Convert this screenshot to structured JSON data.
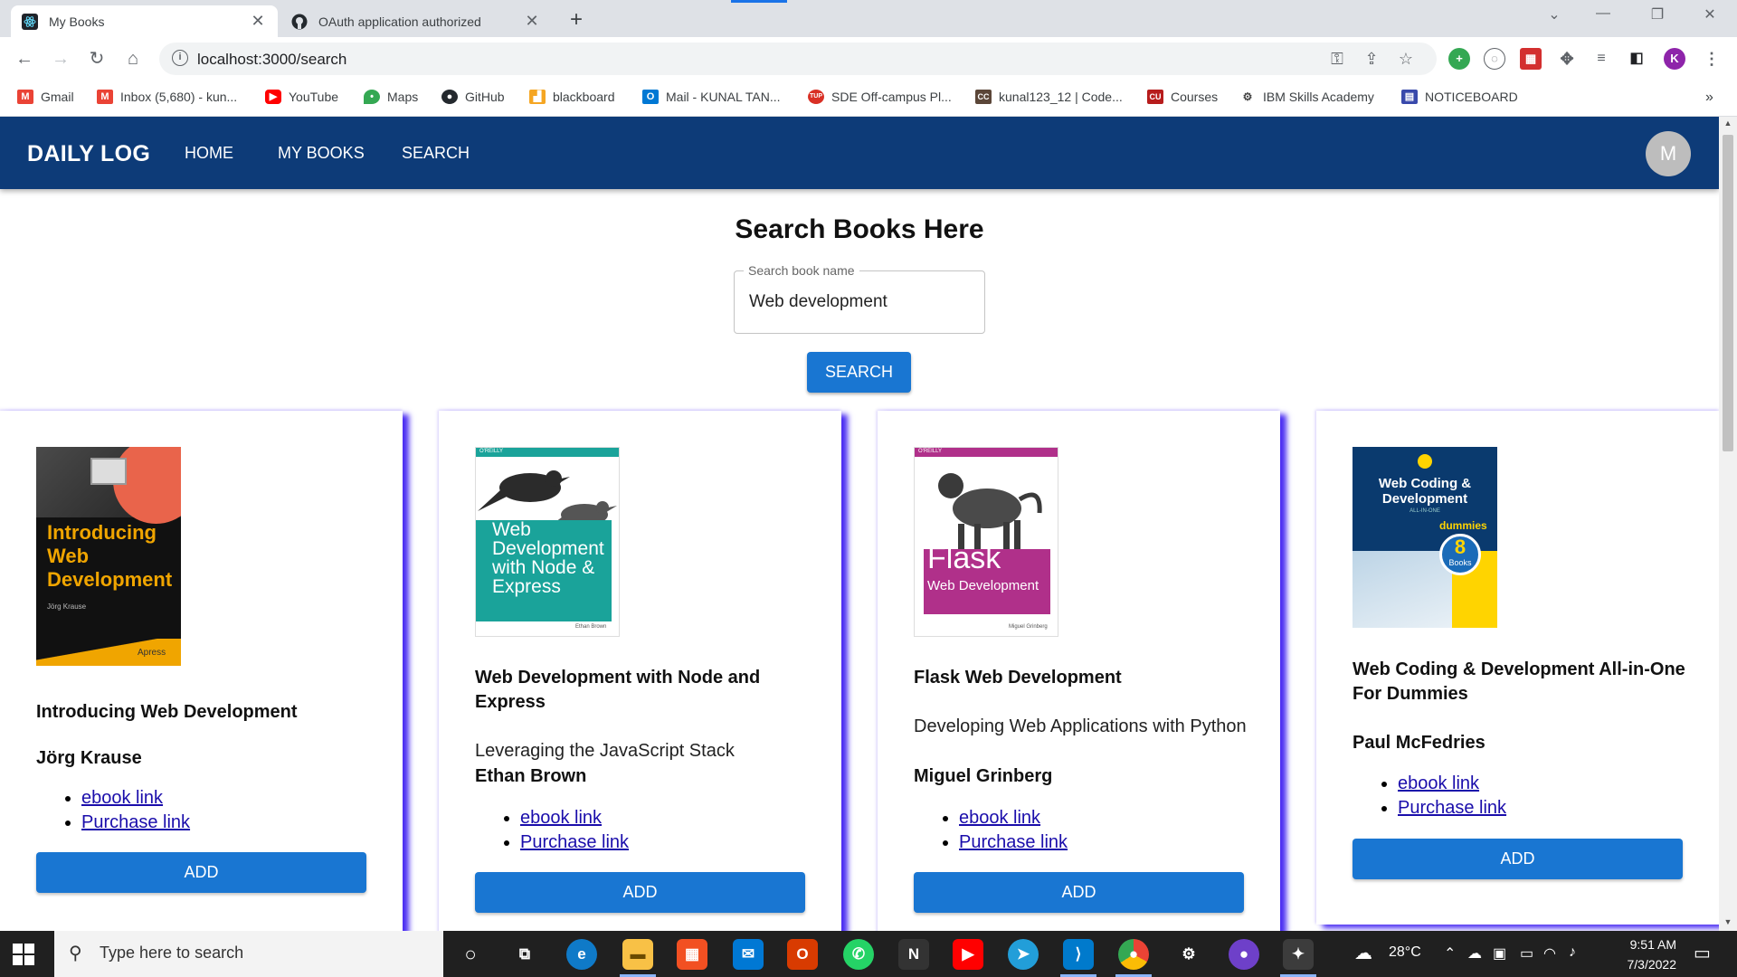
{
  "browser": {
    "tabs": [
      {
        "title": "My Books",
        "close": "✕"
      },
      {
        "title": "OAuth application authorized",
        "close": "✕"
      }
    ],
    "new_tab": "+",
    "window_controls": {
      "minimize": "—",
      "restore": "❐",
      "close": "✕",
      "tab_search": "⌄"
    },
    "url": "localhost:3000/search",
    "profile_initial": "K",
    "bookmarks": [
      {
        "label": "Gmail",
        "icon": "gmail-icon",
        "color": "#ea4335"
      },
      {
        "label": "Inbox (5,680) - kun...",
        "icon": "gmail-icon",
        "color": "#ea4335"
      },
      {
        "label": "YouTube",
        "icon": "youtube-icon",
        "color": "#ff0000"
      },
      {
        "label": "Maps",
        "icon": "maps-icon",
        "color": "#34a853"
      },
      {
        "label": "GitHub",
        "icon": "github-icon",
        "color": "#24292e"
      },
      {
        "label": "blackboard",
        "icon": "blackboard-icon",
        "color": "#f5a623"
      },
      {
        "label": "Mail - KUNAL TAN...",
        "icon": "outlook-icon",
        "color": "#0078d4"
      },
      {
        "label": "SDE Off-campus Pl...",
        "icon": "tup-icon",
        "color": "#d93025"
      },
      {
        "label": "kunal123_12 | Code...",
        "icon": "codechef-icon",
        "color": "#5b4638"
      },
      {
        "label": "Courses",
        "icon": "courses-icon",
        "color": "#b71c1c"
      },
      {
        "label": "IBM Skills Academy",
        "icon": "ibm-icon",
        "color": "#444444"
      },
      {
        "label": "NOTICEBOARD",
        "icon": "noticeboard-icon",
        "color": "#3949ab"
      }
    ],
    "more_bookmarks": "»"
  },
  "app": {
    "brand": "DAILY LOG",
    "nav": [
      "HOME",
      "MY BOOKS",
      "SEARCH"
    ],
    "avatar_initial": "M",
    "page_title": "Search Books Here",
    "search": {
      "label": "Search book name",
      "value": "Web development",
      "button": "SEARCH"
    },
    "add_label": "ADD",
    "books": [
      {
        "title": "Introducing Web Development",
        "subtitle": "",
        "author": "Jörg Krause",
        "links": [
          "ebook link",
          "Purchase link"
        ],
        "cover": {
          "lines": [
            "Introducing",
            "Web",
            "Development"
          ],
          "small": "Jörg Krause",
          "publisher": "Apress",
          "bg": "#111111",
          "accent": "#f0a500"
        }
      },
      {
        "title": "Web Development with Node and Express",
        "subtitle": "Leveraging the JavaScript Stack",
        "author": "Ethan Brown",
        "links": [
          "ebook link",
          "Purchase link"
        ],
        "cover": {
          "lines": [
            "Web",
            "Development",
            "with Node &",
            "Express"
          ],
          "small": "Ethan Brown",
          "publisher": "O'REILLY",
          "bg": "#ffffff",
          "accent": "#1aa39a"
        }
      },
      {
        "title": "Flask Web Development",
        "subtitle": "Developing Web Applications with Python",
        "author": "Miguel Grinberg",
        "links": [
          "ebook link",
          "Purchase link"
        ],
        "cover": {
          "lines": [
            "Flask",
            "Web Development"
          ],
          "small": "Miguel Grinberg",
          "publisher": "O'REILLY",
          "bg": "#ffffff",
          "accent": "#b0308a"
        }
      },
      {
        "title": "Web Coding & Development All-in-One For Dummies",
        "subtitle": "",
        "author": "Paul McFedries",
        "links": [
          "ebook link",
          "Purchase link"
        ],
        "cover": {
          "lines": [
            "Web Coding &",
            "Development"
          ],
          "small": "ALL-IN-ONE",
          "publisher": "dummies",
          "badge": "8",
          "badge_text": "Books",
          "bg": "#0a3a6e",
          "accent": "#ffd400"
        }
      }
    ]
  },
  "taskbar": {
    "search_placeholder": "Type here to search",
    "weather": "28°C",
    "time": "9:51 AM",
    "date": "7/3/2022"
  }
}
